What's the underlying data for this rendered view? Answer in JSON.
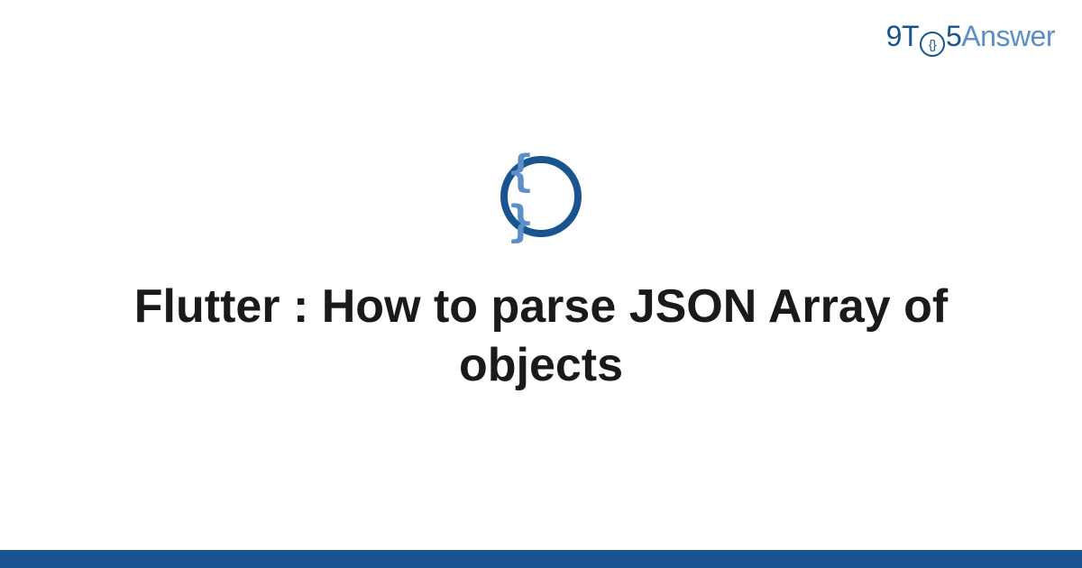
{
  "brand": {
    "nine": "9",
    "t": "T",
    "clock_inner": "{}",
    "five": "5",
    "answer": "Answer"
  },
  "icon": {
    "braces": "{ }"
  },
  "title": "Flutter : How to parse JSON Array of objects"
}
